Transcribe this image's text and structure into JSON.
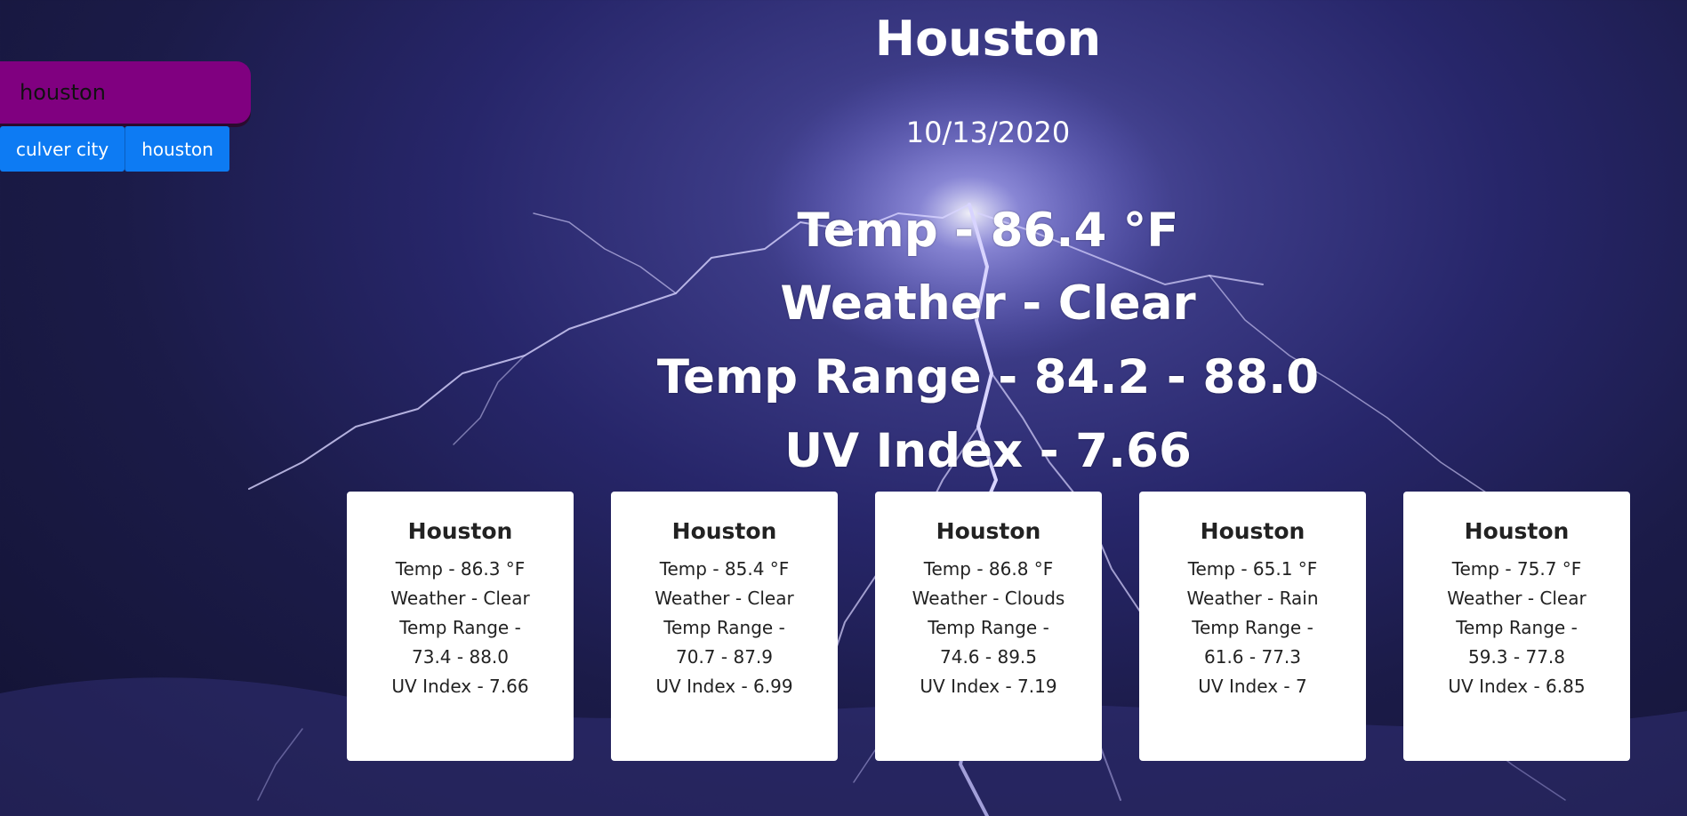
{
  "search": {
    "value": "houston"
  },
  "history": [
    "culver city",
    "houston"
  ],
  "current": {
    "city": "Houston",
    "date": "10/13/2020",
    "temp": "Temp - 86.4 °F",
    "weather": "Weather - Clear",
    "range": "Temp Range - 84.2 - 88.0",
    "uv": "UV Index - 7.66"
  },
  "forecast": [
    {
      "city": "Houston",
      "temp": "Temp - 86.3 °F",
      "weather": "Weather - Clear",
      "range": "Temp Range - 73.4 - 88.0",
      "uv": "UV Index - 7.66"
    },
    {
      "city": "Houston",
      "temp": "Temp - 85.4 °F",
      "weather": "Weather - Clear",
      "range": "Temp Range - 70.7 - 87.9",
      "uv": "UV Index - 6.99"
    },
    {
      "city": "Houston",
      "temp": "Temp - 86.8 °F",
      "weather": "Weather - Clouds",
      "range": "Temp Range - 74.6 - 89.5",
      "uv": "UV Index - 7.19"
    },
    {
      "city": "Houston",
      "temp": "Temp - 65.1 °F",
      "weather": "Weather - Rain",
      "range": "Temp Range - 61.6 - 77.3",
      "uv": "UV Index - 7"
    },
    {
      "city": "Houston",
      "temp": "Temp - 75.7 °F",
      "weather": "Weather - Clear",
      "range": "Temp Range - 59.3 - 77.8",
      "uv": "UV Index - 6.85"
    }
  ],
  "colors": {
    "search_bg": "#800080",
    "history_btn": "#0d7bf3",
    "card_bg": "#ffffff",
    "sky": "#27266a"
  }
}
